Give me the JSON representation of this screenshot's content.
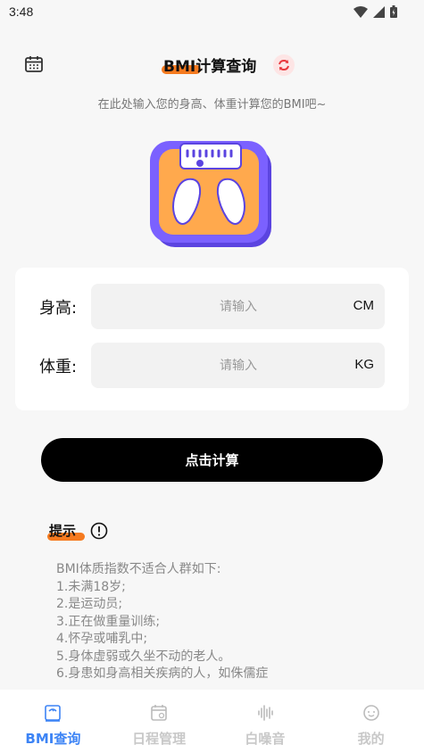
{
  "status_bar": {
    "time": "3:48"
  },
  "header": {
    "title": "BMI计算查询"
  },
  "subtitle": "在此处输入您的身高、体重计算您的BMI吧~",
  "form": {
    "height": {
      "label": "身高:",
      "placeholder": "请输入",
      "unit": "CM"
    },
    "weight": {
      "label": "体重:",
      "placeholder": "请输入",
      "unit": "KG"
    }
  },
  "calc_button": "点击计算",
  "tips": {
    "title": "提示",
    "lines": [
      "BMI体质指数不适合人群如下:",
      "1.未满18岁;",
      "2.是运动员;",
      "3.正在做重量训练;",
      "4.怀孕或哺乳中;",
      "5.身体虚弱或久坐不动的老人。",
      "6.身患如身高相关疾病的人，如侏儒症"
    ]
  },
  "bottom_nav": [
    {
      "label": "BMI查询",
      "icon": "scale-icon",
      "active": true
    },
    {
      "label": "日程管理",
      "icon": "schedule-icon",
      "active": false
    },
    {
      "label": "白噪音",
      "icon": "sound-wave-icon",
      "active": false
    },
    {
      "label": "我的",
      "icon": "smiley-icon",
      "active": false
    }
  ],
  "colors": {
    "accent": "#f57a1f",
    "active_nav": "#3d84f5",
    "scale_purple": "#7b61ff",
    "scale_orange": "#ffa94d"
  }
}
